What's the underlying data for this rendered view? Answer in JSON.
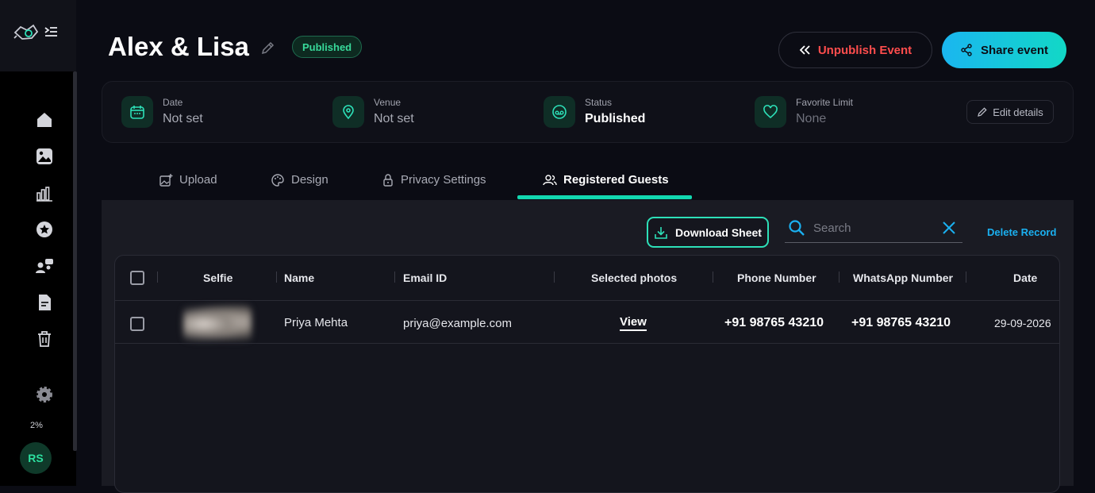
{
  "event": {
    "title": "Alex & Lisa",
    "status_badge": "Published"
  },
  "header": {
    "unpublish_label": "Unpublish Event",
    "share_label": "Share event"
  },
  "info": {
    "date": {
      "label": "Date",
      "value": "Not set"
    },
    "venue": {
      "label": "Venue",
      "value": "Not set"
    },
    "status": {
      "label": "Status",
      "value": "Published"
    },
    "favorite_limit": {
      "label": "Favorite Limit",
      "value": "None"
    },
    "edit_label": "Edit details"
  },
  "tabs": [
    {
      "label": "Upload",
      "icon": "image-plus-icon"
    },
    {
      "label": "Design",
      "icon": "palette-icon"
    },
    {
      "label": "Privacy Settings",
      "icon": "lock-icon"
    },
    {
      "label": "Registered Guests",
      "icon": "users-icon",
      "active": true
    }
  ],
  "toolbar": {
    "download_label": "Download Sheet",
    "search_placeholder": "Search",
    "delete_label": "Delete Record"
  },
  "table": {
    "columns": [
      "Selfie",
      "Name",
      "Email ID",
      "Selected photos",
      "Phone Number",
      "WhatsApp Number",
      "Date"
    ],
    "rows": [
      {
        "name": "Priya Mehta",
        "email": "priya@example.com",
        "selected_photos": "View",
        "phone": "+91 98765 43210",
        "whatsapp": "+91 98765 43210",
        "date": "29-09-2026"
      }
    ]
  },
  "sidebar": {
    "storage": "2%",
    "avatar_initials": "RS",
    "icons": [
      "home-icon",
      "gallery-icon",
      "analytics-icon",
      "star-icon",
      "team-icon",
      "document-icon",
      "trash-icon",
      "settings-icon"
    ]
  },
  "colors": {
    "accent_teal": "#12d8b0",
    "accent_blue": "#1ab0f0",
    "danger": "#ff4d4d",
    "badge_green": "#38d99a"
  }
}
